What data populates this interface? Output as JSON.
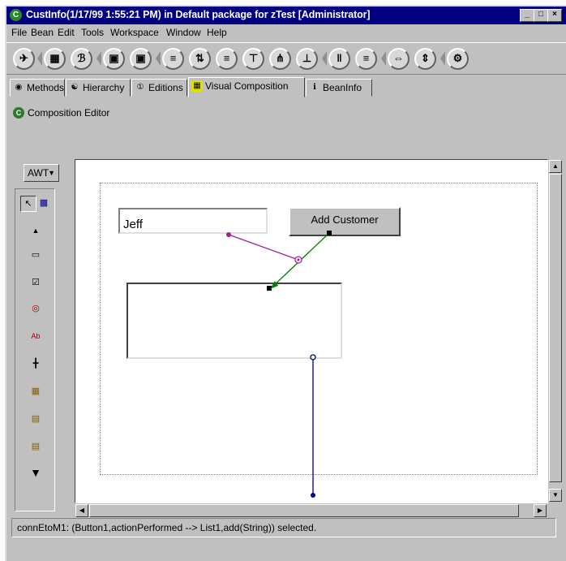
{
  "window": {
    "title": "CustInfo(1/17/99 1:55:21 PM) in Default package for zTest [Administrator]",
    "app_icon": "C",
    "minimize": "_",
    "maximize": "□",
    "close": "×"
  },
  "menu": [
    "File",
    "Bean",
    "Edit",
    "Tools",
    "Workspace",
    "Window",
    "Help"
  ],
  "tabs": [
    {
      "label": "Methods",
      "icon": "methods-icon"
    },
    {
      "label": "Hierarchy",
      "icon": "hierarchy-icon"
    },
    {
      "label": "Editions",
      "icon": "editions-icon"
    },
    {
      "label": "Visual Composition",
      "icon": "visual-composition-icon",
      "active": true
    },
    {
      "label": "BeanInfo",
      "icon": "beaninfo-icon"
    }
  ],
  "composition_editor": {
    "title": "Composition Editor",
    "palette_selector": "AWT"
  },
  "beans": {
    "text_field_value": "Jeff",
    "button_label": "Add Customer"
  },
  "status": {
    "text": "connEtoM1:  (Button1,actionPerformed --> List1,add(String)) selected."
  },
  "colors": {
    "titlebar": "#000080",
    "connection_event": "#008000",
    "connection_parameter": "#a020a0",
    "connection_property": "#000080"
  }
}
